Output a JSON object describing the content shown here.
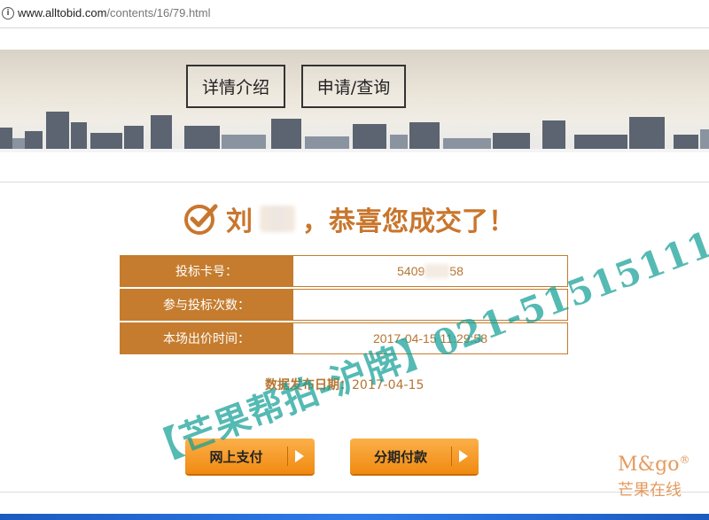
{
  "browser": {
    "url_host": "www.alltobid.com",
    "url_path": "/contents/16/79.html"
  },
  "nav": {
    "details": "详情介绍",
    "apply": "申请/查询"
  },
  "result": {
    "surname": "刘",
    "message": "，恭喜您成交了！"
  },
  "rows": [
    {
      "label": "投标卡号：",
      "value_prefix": "5409",
      "value_suffix": "58"
    },
    {
      "label": "参与投标次数：",
      "value": ""
    },
    {
      "label": "本场出价时间：",
      "value": "2017-04-15 11:29:58"
    }
  ],
  "publish": {
    "label": "数据发布日期：",
    "date": "2017-04-15"
  },
  "buttons": {
    "online_pay": "网上支付",
    "installment": "分期付款"
  },
  "watermark": {
    "text": "【芒果帮拍-沪牌】021-51515111"
  },
  "logo": {
    "brand": "M&go",
    "mark": "®",
    "caption": "芒果在线"
  },
  "colors": {
    "accent": "#c57c2e",
    "button": "#f39a1f",
    "watermark": "#14a096"
  }
}
